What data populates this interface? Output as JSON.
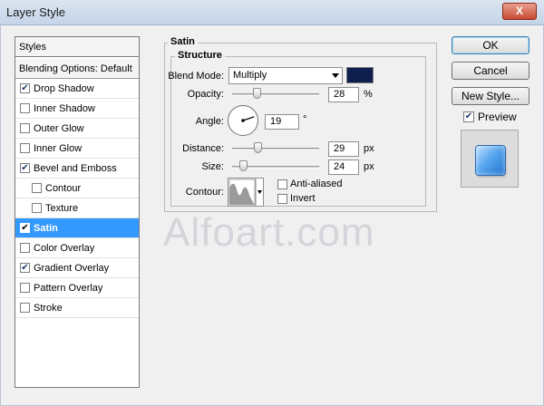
{
  "window": {
    "title": "Layer Style",
    "close_glyph": "X"
  },
  "styles_panel": {
    "header": "Styles",
    "blending_options": "Blending Options: Default",
    "items": [
      {
        "label": "Drop Shadow",
        "checked": true,
        "indent": false,
        "active": false
      },
      {
        "label": "Inner Shadow",
        "checked": false,
        "indent": false,
        "active": false
      },
      {
        "label": "Outer Glow",
        "checked": false,
        "indent": false,
        "active": false
      },
      {
        "label": "Inner Glow",
        "checked": false,
        "indent": false,
        "active": false
      },
      {
        "label": "Bevel and Emboss",
        "checked": true,
        "indent": false,
        "active": false
      },
      {
        "label": "Contour",
        "checked": false,
        "indent": true,
        "active": false
      },
      {
        "label": "Texture",
        "checked": false,
        "indent": true,
        "active": false
      },
      {
        "label": "Satin",
        "checked": true,
        "indent": false,
        "active": true
      },
      {
        "label": "Color Overlay",
        "checked": false,
        "indent": false,
        "active": false
      },
      {
        "label": "Gradient Overlay",
        "checked": true,
        "indent": false,
        "active": false
      },
      {
        "label": "Pattern Overlay",
        "checked": false,
        "indent": false,
        "active": false
      },
      {
        "label": "Stroke",
        "checked": false,
        "indent": false,
        "active": false
      }
    ]
  },
  "satin": {
    "group_title": "Satin",
    "structure_title": "Structure",
    "blend_mode_label": "Blend Mode:",
    "blend_mode_value": "Multiply",
    "color": "#0f1f4d",
    "opacity_label": "Opacity:",
    "opacity_value": "28",
    "opacity_unit": "%",
    "opacity_level": 0.28,
    "angle_label": "Angle:",
    "angle_value": "19",
    "angle_unit": "°",
    "distance_label": "Distance:",
    "distance_value": "29",
    "distance_unit": "px",
    "distance_level": 0.29,
    "size_label": "Size:",
    "size_value": "24",
    "size_unit": "px",
    "size_level": 0.12,
    "contour_label": "Contour:",
    "anti_aliased_label": "Anti-aliased",
    "anti_aliased_checked": false,
    "invert_label": "Invert",
    "invert_checked": false
  },
  "buttons": {
    "ok": "OK",
    "cancel": "Cancel",
    "new_style": "New Style...",
    "preview_label": "Preview",
    "preview_checked": true
  },
  "watermark": "Alfoart.com"
}
